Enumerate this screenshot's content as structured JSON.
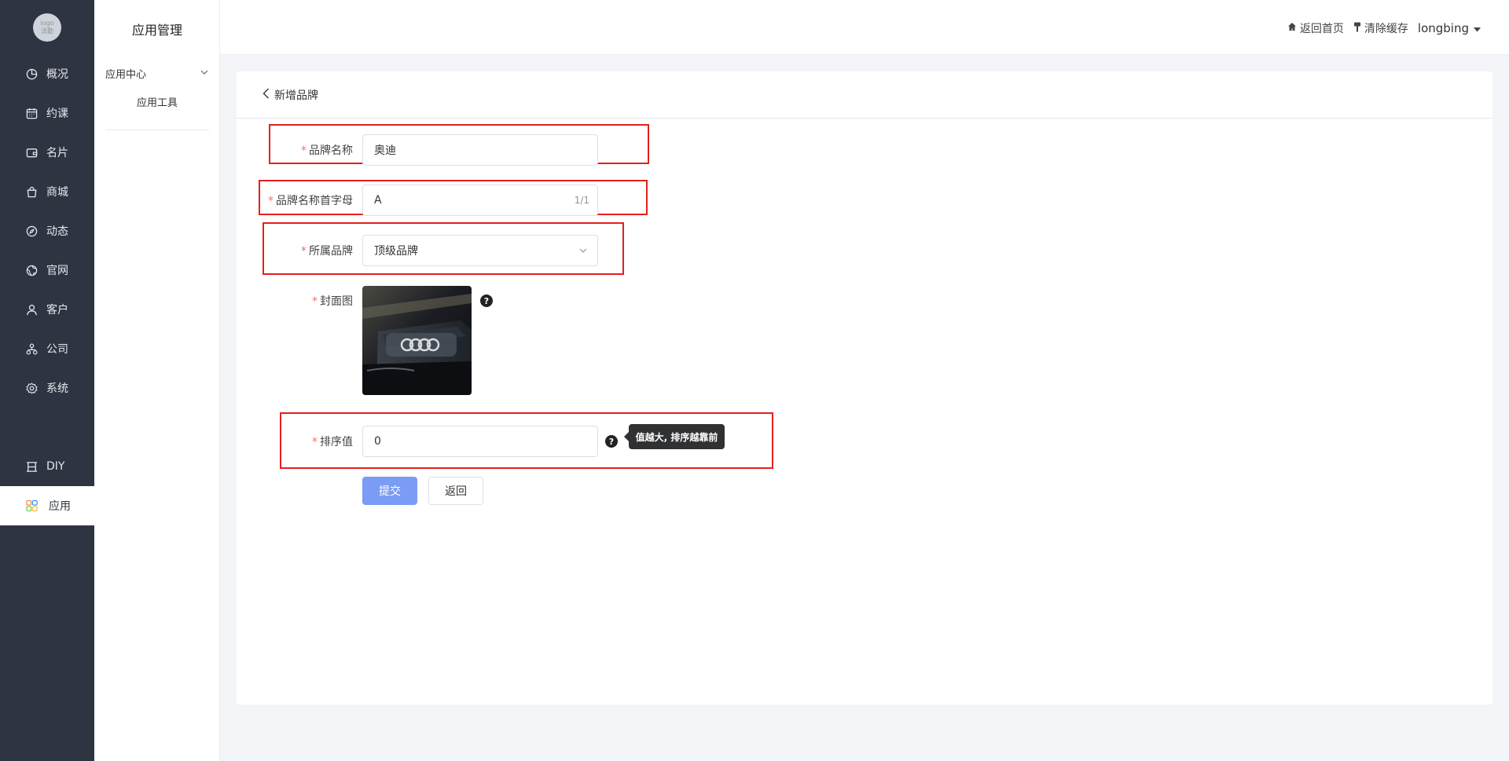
{
  "sidebar": {
    "logo_text": "logo\n法勤",
    "items": [
      {
        "label": "概况",
        "icon": "pie-chart-icon"
      },
      {
        "label": "约课",
        "icon": "calendar-icon"
      },
      {
        "label": "名片",
        "icon": "wallet-icon"
      },
      {
        "label": "商城",
        "icon": "shopping-bag-icon"
      },
      {
        "label": "动态",
        "icon": "compass-icon"
      },
      {
        "label": "官网",
        "icon": "globe-icon"
      },
      {
        "label": "客户",
        "icon": "user-icon"
      },
      {
        "label": "公司",
        "icon": "org-chart-icon"
      },
      {
        "label": "系统",
        "icon": "gear-icon"
      },
      {
        "label": "DIY",
        "icon": "diy-icon"
      },
      {
        "label": "应用",
        "icon": "apps-icon",
        "active": true
      }
    ]
  },
  "subnav": {
    "title": "应用管理",
    "group": "应用中心",
    "sub_item": "应用工具"
  },
  "header": {
    "home_label": "返回首页",
    "clear_cache_label": "清除缓存",
    "username": "longbing"
  },
  "page": {
    "back_title": "新增品牌"
  },
  "form": {
    "brand_name": {
      "label": "品牌名称",
      "value": "奥迪"
    },
    "initial": {
      "label": "品牌名称首字母",
      "value": "A",
      "count": "1/1"
    },
    "parent_brand": {
      "label": "所属品牌",
      "value": "顶级品牌"
    },
    "cover": {
      "label": "封面图"
    },
    "sort": {
      "label": "排序值",
      "value": "0",
      "tooltip": "值越大, 排序越靠前"
    },
    "submit_label": "提交",
    "back_label": "返回"
  },
  "colors": {
    "sidebar_bg": "#2e3442",
    "accent": "#7a9cf4",
    "highlight_box": "#e41f1f",
    "required_star": "#f56c6c"
  }
}
